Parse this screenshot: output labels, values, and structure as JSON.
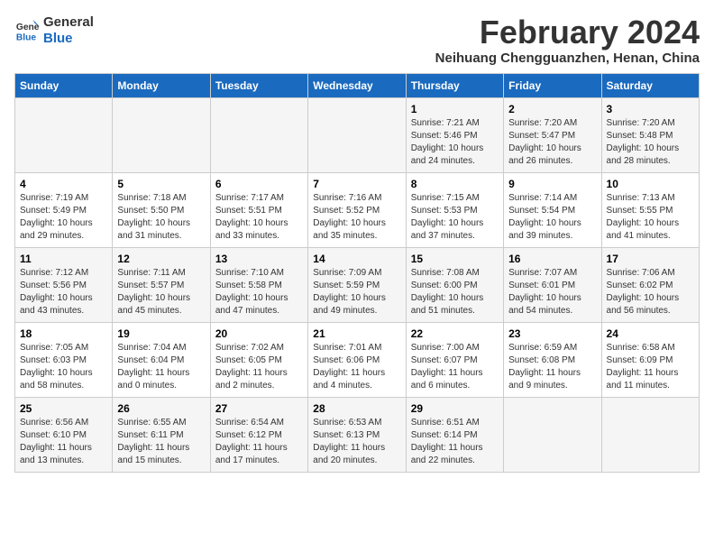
{
  "logo": {
    "line1": "General",
    "line2": "Blue"
  },
  "title": "February 2024",
  "subtitle": "Neihuang Chengguanzhen, Henan, China",
  "days_of_week": [
    "Sunday",
    "Monday",
    "Tuesday",
    "Wednesday",
    "Thursday",
    "Friday",
    "Saturday"
  ],
  "weeks": [
    [
      {
        "day": "",
        "info": ""
      },
      {
        "day": "",
        "info": ""
      },
      {
        "day": "",
        "info": ""
      },
      {
        "day": "",
        "info": ""
      },
      {
        "day": "1",
        "info": "Sunrise: 7:21 AM\nSunset: 5:46 PM\nDaylight: 10 hours\nand 24 minutes."
      },
      {
        "day": "2",
        "info": "Sunrise: 7:20 AM\nSunset: 5:47 PM\nDaylight: 10 hours\nand 26 minutes."
      },
      {
        "day": "3",
        "info": "Sunrise: 7:20 AM\nSunset: 5:48 PM\nDaylight: 10 hours\nand 28 minutes."
      }
    ],
    [
      {
        "day": "4",
        "info": "Sunrise: 7:19 AM\nSunset: 5:49 PM\nDaylight: 10 hours\nand 29 minutes."
      },
      {
        "day": "5",
        "info": "Sunrise: 7:18 AM\nSunset: 5:50 PM\nDaylight: 10 hours\nand 31 minutes."
      },
      {
        "day": "6",
        "info": "Sunrise: 7:17 AM\nSunset: 5:51 PM\nDaylight: 10 hours\nand 33 minutes."
      },
      {
        "day": "7",
        "info": "Sunrise: 7:16 AM\nSunset: 5:52 PM\nDaylight: 10 hours\nand 35 minutes."
      },
      {
        "day": "8",
        "info": "Sunrise: 7:15 AM\nSunset: 5:53 PM\nDaylight: 10 hours\nand 37 minutes."
      },
      {
        "day": "9",
        "info": "Sunrise: 7:14 AM\nSunset: 5:54 PM\nDaylight: 10 hours\nand 39 minutes."
      },
      {
        "day": "10",
        "info": "Sunrise: 7:13 AM\nSunset: 5:55 PM\nDaylight: 10 hours\nand 41 minutes."
      }
    ],
    [
      {
        "day": "11",
        "info": "Sunrise: 7:12 AM\nSunset: 5:56 PM\nDaylight: 10 hours\nand 43 minutes."
      },
      {
        "day": "12",
        "info": "Sunrise: 7:11 AM\nSunset: 5:57 PM\nDaylight: 10 hours\nand 45 minutes."
      },
      {
        "day": "13",
        "info": "Sunrise: 7:10 AM\nSunset: 5:58 PM\nDaylight: 10 hours\nand 47 minutes."
      },
      {
        "day": "14",
        "info": "Sunrise: 7:09 AM\nSunset: 5:59 PM\nDaylight: 10 hours\nand 49 minutes."
      },
      {
        "day": "15",
        "info": "Sunrise: 7:08 AM\nSunset: 6:00 PM\nDaylight: 10 hours\nand 51 minutes."
      },
      {
        "day": "16",
        "info": "Sunrise: 7:07 AM\nSunset: 6:01 PM\nDaylight: 10 hours\nand 54 minutes."
      },
      {
        "day": "17",
        "info": "Sunrise: 7:06 AM\nSunset: 6:02 PM\nDaylight: 10 hours\nand 56 minutes."
      }
    ],
    [
      {
        "day": "18",
        "info": "Sunrise: 7:05 AM\nSunset: 6:03 PM\nDaylight: 10 hours\nand 58 minutes."
      },
      {
        "day": "19",
        "info": "Sunrise: 7:04 AM\nSunset: 6:04 PM\nDaylight: 11 hours\nand 0 minutes."
      },
      {
        "day": "20",
        "info": "Sunrise: 7:02 AM\nSunset: 6:05 PM\nDaylight: 11 hours\nand 2 minutes."
      },
      {
        "day": "21",
        "info": "Sunrise: 7:01 AM\nSunset: 6:06 PM\nDaylight: 11 hours\nand 4 minutes."
      },
      {
        "day": "22",
        "info": "Sunrise: 7:00 AM\nSunset: 6:07 PM\nDaylight: 11 hours\nand 6 minutes."
      },
      {
        "day": "23",
        "info": "Sunrise: 6:59 AM\nSunset: 6:08 PM\nDaylight: 11 hours\nand 9 minutes."
      },
      {
        "day": "24",
        "info": "Sunrise: 6:58 AM\nSunset: 6:09 PM\nDaylight: 11 hours\nand 11 minutes."
      }
    ],
    [
      {
        "day": "25",
        "info": "Sunrise: 6:56 AM\nSunset: 6:10 PM\nDaylight: 11 hours\nand 13 minutes."
      },
      {
        "day": "26",
        "info": "Sunrise: 6:55 AM\nSunset: 6:11 PM\nDaylight: 11 hours\nand 15 minutes."
      },
      {
        "day": "27",
        "info": "Sunrise: 6:54 AM\nSunset: 6:12 PM\nDaylight: 11 hours\nand 17 minutes."
      },
      {
        "day": "28",
        "info": "Sunrise: 6:53 AM\nSunset: 6:13 PM\nDaylight: 11 hours\nand 20 minutes."
      },
      {
        "day": "29",
        "info": "Sunrise: 6:51 AM\nSunset: 6:14 PM\nDaylight: 11 hours\nand 22 minutes."
      },
      {
        "day": "",
        "info": ""
      },
      {
        "day": "",
        "info": ""
      }
    ]
  ]
}
